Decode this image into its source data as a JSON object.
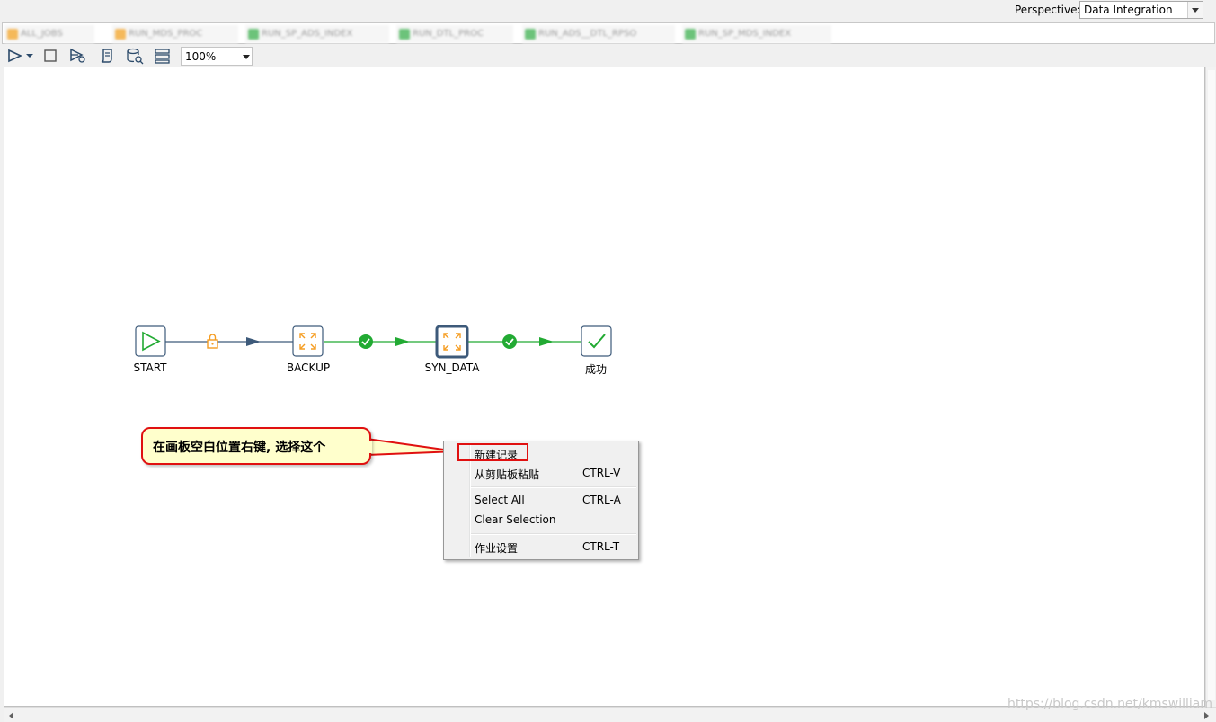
{
  "perspective": {
    "label": "Perspective:",
    "value": "Data Integration"
  },
  "tabs": [
    {
      "label": "ALL_JOBS",
      "color": "#f5b95a"
    },
    {
      "label": "RUN_MDS_PROC",
      "color": "#f5b95a"
    },
    {
      "label": "RUN_SP_ADS_INDEX",
      "color": "#6cc37a"
    },
    {
      "label": "RUN_DTL_PROC",
      "color": "#6cc37a"
    },
    {
      "label": "RUN_ADS__DTL_RPSO",
      "color": "#6cc37a"
    },
    {
      "label": "RUN_SP_MDS_INDEX",
      "color": "#6cc37a"
    }
  ],
  "toolbar": {
    "zoom": "100%",
    "icons": [
      "run-icon",
      "run-options-icon",
      "stop-icon",
      "preview-icon",
      "script-icon",
      "sql-icon",
      "layers-icon"
    ]
  },
  "job": {
    "nodes": [
      {
        "label": "START",
        "icon": "play-icon"
      },
      {
        "label": "BACKUP",
        "icon": "transform-icon"
      },
      {
        "label": "SYN_DATA",
        "icon": "transform-icon"
      },
      {
        "label": "成功",
        "icon": "check-icon"
      }
    ],
    "hops": [
      {
        "icon": "lock-icon"
      },
      {
        "icon": "success-icon"
      },
      {
        "icon": "success-icon"
      }
    ]
  },
  "callout": {
    "text": "在画板空白位置右键, 选择这个"
  },
  "context_menu": {
    "items": [
      {
        "label": "新建记录",
        "shortcut": ""
      },
      {
        "label": "从剪贴板粘贴",
        "shortcut": "CTRL-V"
      },
      {
        "label": "Select All",
        "shortcut": "CTRL-A"
      },
      {
        "label": "Clear Selection",
        "shortcut": ""
      },
      {
        "label": "作业设置",
        "shortcut": "CTRL-T"
      }
    ]
  },
  "watermark": "https://blog.csdn.net/kmswilliam",
  "colors": {
    "accent_red": "#e01010",
    "hop_green": "#22aa33",
    "hop_blue": "#3d5a7a",
    "node_orange": "#f59d22"
  }
}
